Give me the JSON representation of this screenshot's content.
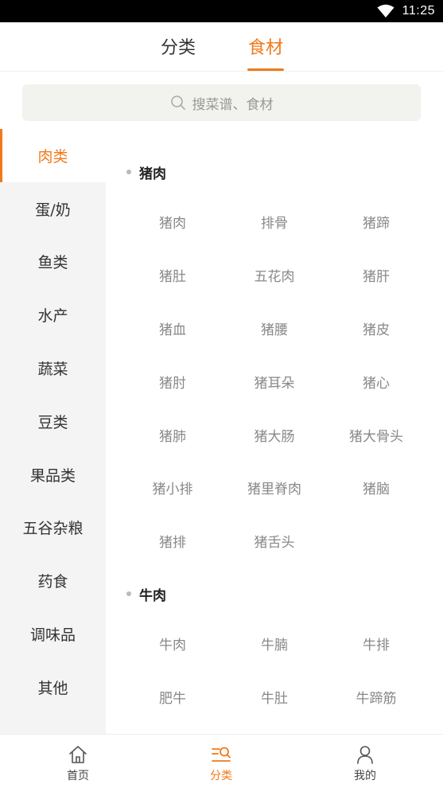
{
  "status_bar": {
    "time": "11:25"
  },
  "top_tabs": [
    {
      "label": "分类",
      "active": false
    },
    {
      "label": "食材",
      "active": true
    }
  ],
  "search": {
    "placeholder": "搜菜谱、食材"
  },
  "sidebar": {
    "items": [
      {
        "label": "肉类",
        "active": true
      },
      {
        "label": "蛋/奶"
      },
      {
        "label": "鱼类"
      },
      {
        "label": "水产"
      },
      {
        "label": "蔬菜"
      },
      {
        "label": "豆类"
      },
      {
        "label": "果品类"
      },
      {
        "label": "五谷杂粮"
      },
      {
        "label": "药食"
      },
      {
        "label": "调味品"
      },
      {
        "label": "其他"
      }
    ]
  },
  "sections": [
    {
      "title": "猪肉",
      "items": [
        "猪肉",
        "排骨",
        "猪蹄",
        "猪肚",
        "五花肉",
        "猪肝",
        "猪血",
        "猪腰",
        "猪皮",
        "猪肘",
        "猪耳朵",
        "猪心",
        "猪肺",
        "猪大肠",
        "猪大骨头",
        "猪小排",
        "猪里脊肉",
        "猪脑",
        "猪排",
        "猪舌头"
      ]
    },
    {
      "title": "牛肉",
      "items": [
        "牛肉",
        "牛腩",
        "牛排",
        "肥牛",
        "牛肚",
        "牛蹄筋"
      ]
    }
  ],
  "bottom_nav": [
    {
      "label": "首页",
      "icon": "home-icon",
      "active": false
    },
    {
      "label": "分类",
      "icon": "category-icon",
      "active": true
    },
    {
      "label": "我的",
      "icon": "user-icon",
      "active": false
    }
  ],
  "colors": {
    "accent": "#f07a1a",
    "sidebar_bg": "#f4f4f4",
    "search_bg": "#f2f2ee"
  }
}
